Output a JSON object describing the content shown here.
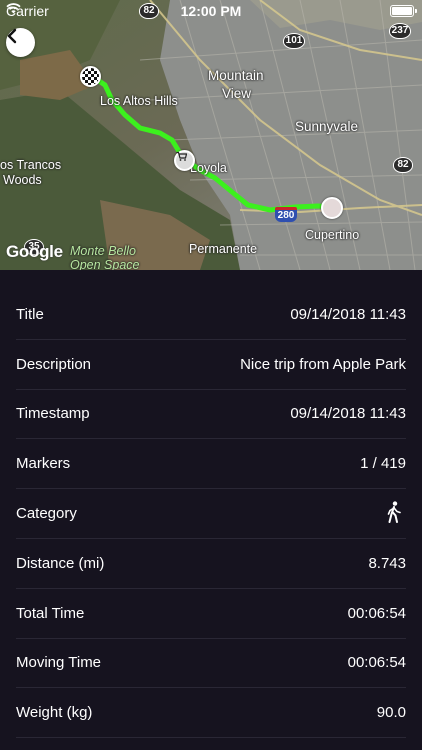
{
  "status_bar": {
    "carrier": "Carrier",
    "time": "12:00 PM",
    "wifi_icon": "wifi-icon",
    "battery_icon": "battery-icon"
  },
  "map": {
    "back_icon": "chevron-left-icon",
    "labels": {
      "mountain_view_1": "Mountain",
      "mountain_view_2": "View",
      "sunnyvale": "Sunnyvale",
      "los_altos_hills": "Los Altos Hills",
      "loyola": "Loyola",
      "los_trancos_1": "os Trancos",
      "los_trancos_2": "Woods",
      "cupertino": "Cupertino",
      "permanente": "Permanente",
      "monte_bello_1": "Monte Bello",
      "monte_bello_2": "Open Space"
    },
    "shields": {
      "s82_top": "82",
      "s101": "101",
      "s237": "237",
      "s82_right": "82",
      "s35": "35",
      "i280": "280"
    },
    "logo": "Google",
    "colors": {
      "route": "#3cf01e",
      "background": "#16131f"
    }
  },
  "details": [
    {
      "label": "Title",
      "value": "09/14/2018 11:43"
    },
    {
      "label": "Description",
      "value": "Nice trip from Apple Park"
    },
    {
      "label": "Timestamp",
      "value": "09/14/2018 11:43"
    },
    {
      "label": "Markers",
      "value": "1 / 419"
    },
    {
      "label": "Category",
      "value": "",
      "icon": "walking-person-icon"
    },
    {
      "label": "Distance (mi)",
      "value": "8.743"
    },
    {
      "label": "Total Time",
      "value": "00:06:54"
    },
    {
      "label": "Moving Time",
      "value": "00:06:54"
    },
    {
      "label": "Weight (kg)",
      "value": "90.0"
    }
  ]
}
